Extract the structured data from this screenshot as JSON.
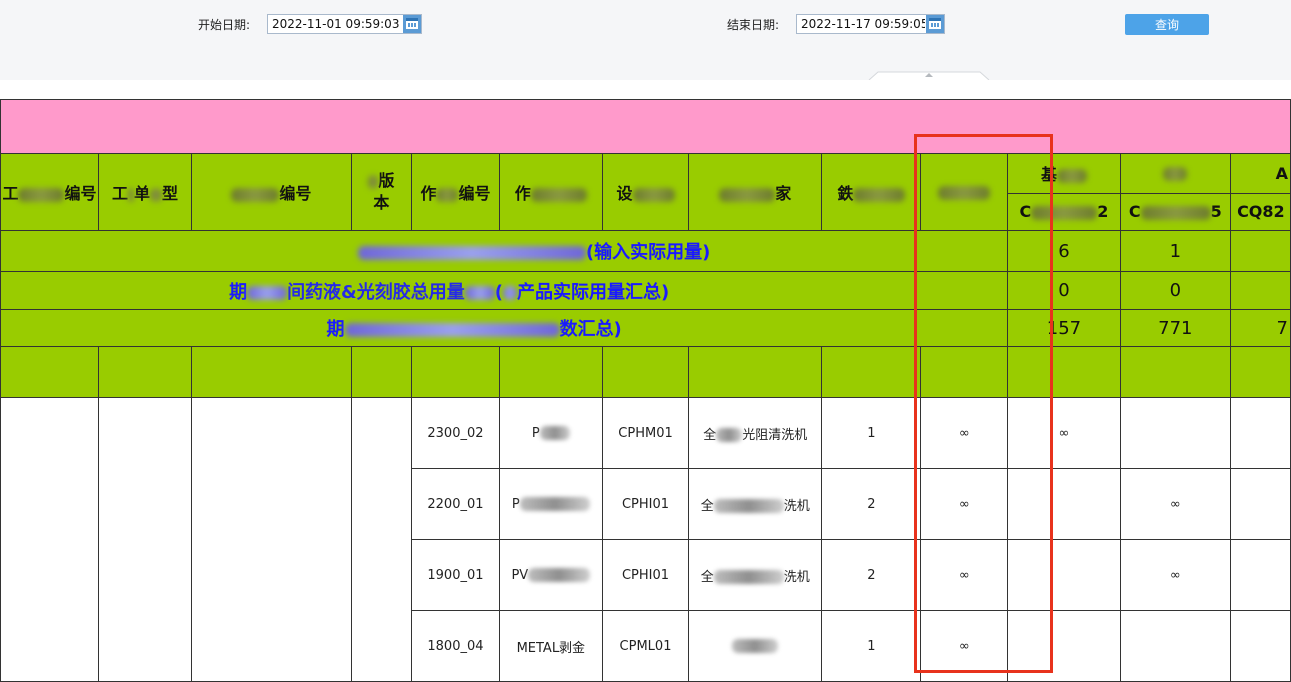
{
  "filter": {
    "start_label": "开始日期:",
    "start_value": "2022-11-01 09:59:03",
    "end_label": "结束日期:",
    "end_value": "2022-11-17 09:59:05",
    "query_label": "查询"
  },
  "headers": {
    "h1": "工",
    "h1_tail": "编号",
    "h2": "工",
    "h2_mid": "单",
    "h2_tail": "型",
    "h3_tail": "编号",
    "h4_top": "版",
    "h4_bottom": "本",
    "h5_head": "作",
    "h5_tail": "编号",
    "h6_head": "作",
    "h7_head": "设",
    "h8_tail": "家",
    "h9_head": "鉄",
    "h11_top": "基",
    "h13_top": "A",
    "sub1_head": "C",
    "sub1_tail": "2",
    "sub2_head": "C",
    "sub2_tail": "5",
    "sub3": "CQ82"
  },
  "summary": [
    {
      "label": "(输入实际用量)",
      "values": [
        "6",
        "1"
      ]
    },
    {
      "label_head": "期",
      "label_mid": "间药液&光刻胶总用量",
      "label_paren": "(",
      "label_tail": "产品实际用量汇总)",
      "values": [
        "0",
        "0"
      ]
    },
    {
      "label_head": "期",
      "label_tail": "数汇总)",
      "values": [
        "157",
        "771",
        "7"
      ]
    }
  ],
  "rows": [
    {
      "op_no": "2300_02",
      "op_name": "P",
      "device": "CPHM01",
      "device_name_head": "全",
      "device_name_tail": "光阻清洗机",
      "num": "1",
      "inf_col10": "∞",
      "inf_col11": "∞",
      "inf_col12": ""
    },
    {
      "op_no": "2200_01",
      "op_name": "P",
      "device": "CPHI01",
      "device_name_head": "全",
      "device_name_tail": "洗机",
      "num": "2",
      "inf_col10": "∞",
      "inf_col11": "",
      "inf_col12": "∞"
    },
    {
      "op_no": "1900_01",
      "op_name": "PV",
      "device": "CPHI01",
      "device_name_head": "全",
      "device_name_tail": "洗机",
      "num": "2",
      "inf_col10": "∞",
      "inf_col11": "",
      "inf_col12": "∞"
    },
    {
      "op_no": "1800_04",
      "op_name": "METAL剥金",
      "device": "CPML01",
      "device_name_head": "",
      "device_name_tail": "",
      "num": "1",
      "inf_col10": "∞",
      "inf_col11": "",
      "inf_col12": ""
    }
  ]
}
